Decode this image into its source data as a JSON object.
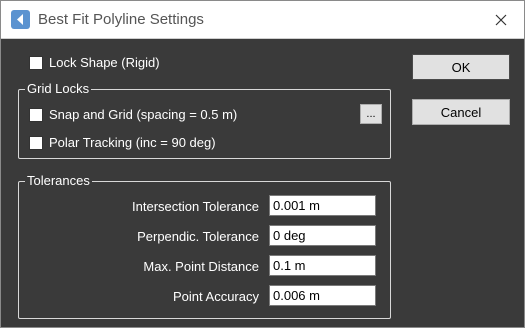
{
  "window": {
    "title": "Best Fit Polyline Settings",
    "icons": {
      "app": "back-arrow-app-icon",
      "close": "close-icon"
    }
  },
  "lock_shape": {
    "label": "Lock Shape (Rigid)",
    "checked": false
  },
  "grid_locks": {
    "legend": "Grid Locks",
    "snap_and_grid": {
      "label": "Snap and Grid (spacing = 0.5 m)",
      "checked": false
    },
    "browse_label": "...",
    "polar_tracking": {
      "label": "Polar Tracking (inc = 90 deg)",
      "checked": false
    }
  },
  "tolerances": {
    "legend": "Tolerances",
    "fields": [
      {
        "label": "Intersection Tolerance",
        "value": "0.001 m"
      },
      {
        "label": "Perpendic. Tolerance",
        "value": "0 deg"
      },
      {
        "label": "Max. Point Distance",
        "value": "0.1 m"
      },
      {
        "label": "Point Accuracy",
        "value": "0.006 m"
      }
    ]
  },
  "buttons": {
    "ok": "OK",
    "cancel": "Cancel"
  },
  "colors": {
    "dialog_bg": "#3a3a3a",
    "titlebar_bg": "#ffffff",
    "app_icon": "#5b93d0"
  }
}
